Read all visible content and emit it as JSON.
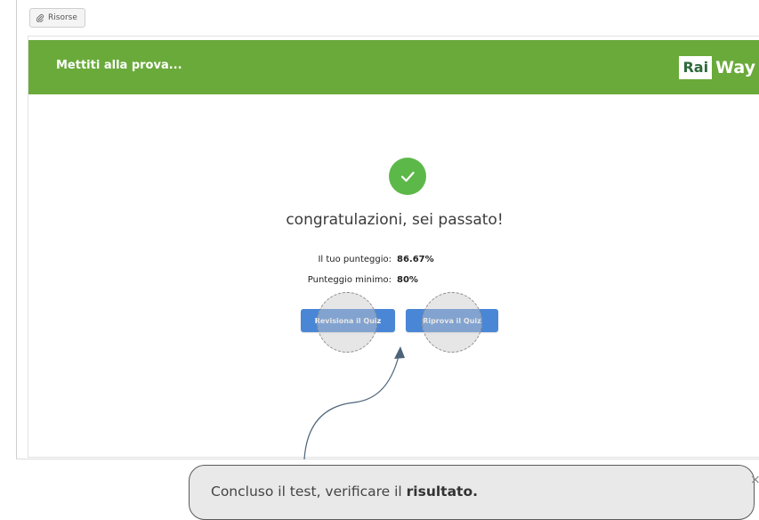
{
  "toolbar": {
    "resources_label": "Risorse",
    "resources_icon": "paperclip-icon"
  },
  "banner": {
    "title": "Mettiti alla prova...",
    "logo_left": "Rai",
    "logo_right": "Way",
    "color": "#6aaa3a"
  },
  "result": {
    "status_icon": "checkmark-icon",
    "heading": "congratulazioni, sei passato!",
    "score_label": "Il tuo punteggio:",
    "score_value": "86.67%",
    "min_label": "Punteggio minimo:",
    "min_value": "80%"
  },
  "buttons": {
    "review": "Revisiona il Quiz",
    "retry": "Riprova il Quiz",
    "color": "#4a86d6"
  },
  "tooltip": {
    "text_prefix": "Concluso il test, verificare il ",
    "text_bold": "risultato.",
    "close": "×"
  }
}
